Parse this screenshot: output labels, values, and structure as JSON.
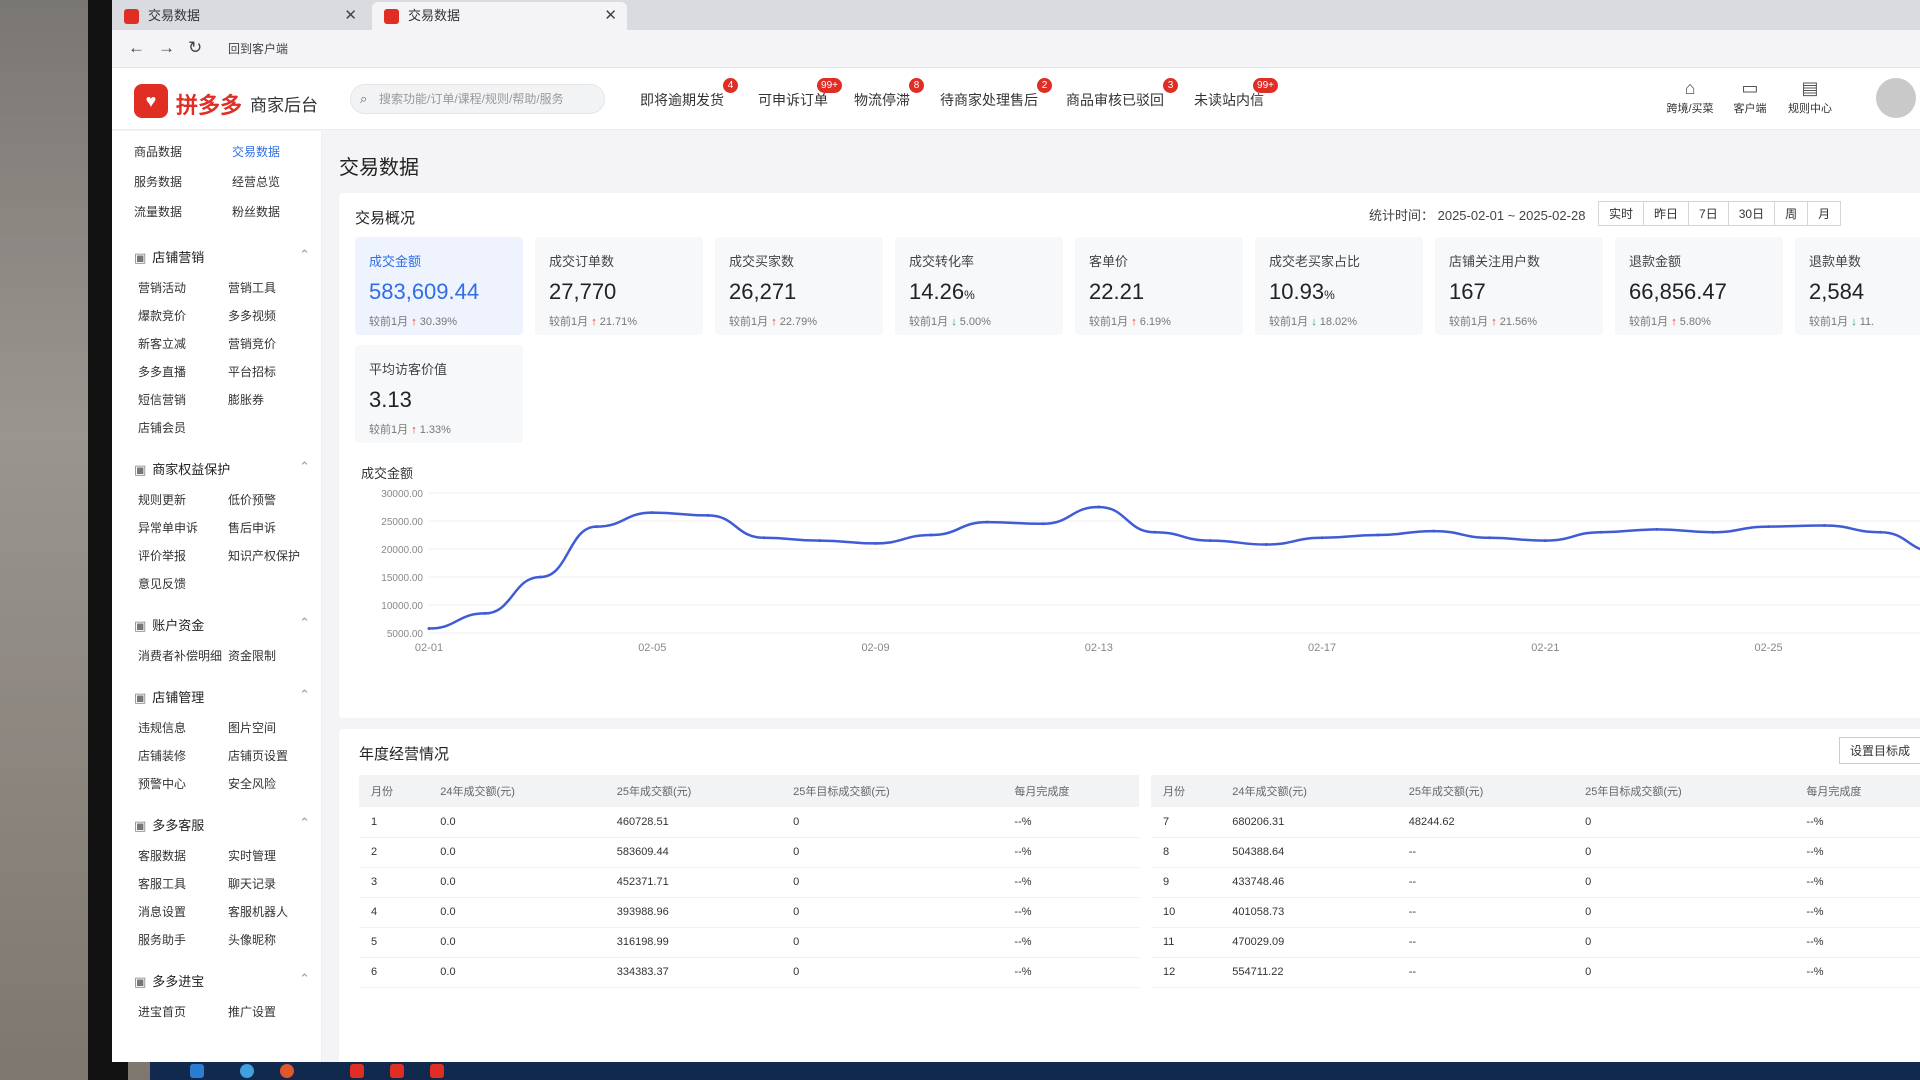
{
  "browser": {
    "tabs": [
      {
        "label": "交易数据"
      },
      {
        "label": "交易数据"
      }
    ],
    "address_label": "回到客户端"
  },
  "header": {
    "brand": "拼多多",
    "brand_sub": "商家后台",
    "search_placeholder": "搜索功能/订单/课程/规则/帮助/服务",
    "notices": [
      {
        "label": "即将逾期发货",
        "badge": "4"
      },
      {
        "label": "可申诉订单",
        "badge": "99+"
      },
      {
        "label": "物流停滞",
        "badge": "8"
      },
      {
        "label": "待商家处理售后",
        "badge": "2"
      },
      {
        "label": "商品审核已驳回",
        "badge": "3"
      },
      {
        "label": "未读站内信",
        "badge": "99+"
      }
    ],
    "tools": [
      "跨境/买菜",
      "客户端",
      "规则中心"
    ]
  },
  "sidebar": {
    "top_items": [
      [
        "商品数据",
        "交易数据"
      ],
      [
        "服务数据",
        "经营总览"
      ],
      [
        "流量数据",
        "粉丝数据"
      ]
    ],
    "sections": [
      {
        "title": "店铺营销",
        "items": [
          [
            "营销活动",
            "营销工具"
          ],
          [
            "爆款竞价",
            "多多视频"
          ],
          [
            "新客立减",
            "营销竞价"
          ],
          [
            "多多直播",
            "平台招标"
          ],
          [
            "短信营销",
            "膨胀券"
          ],
          [
            "店铺会员",
            ""
          ]
        ]
      },
      {
        "title": "商家权益保护",
        "items": [
          [
            "规则更新",
            "低价预警"
          ],
          [
            "异常单申诉",
            "售后申诉"
          ],
          [
            "评价举报",
            "知识产权保护"
          ],
          [
            "意见反馈",
            ""
          ]
        ]
      },
      {
        "title": "账户资金",
        "items": [
          [
            "消费者补偿明细",
            "资金限制"
          ]
        ]
      },
      {
        "title": "店铺管理",
        "items": [
          [
            "违规信息",
            "图片空间"
          ],
          [
            "店铺装修",
            "店铺页设置"
          ],
          [
            "预警中心",
            "安全风险"
          ]
        ]
      },
      {
        "title": "多多客服",
        "items": [
          [
            "客服数据",
            "实时管理"
          ],
          [
            "客服工具",
            "聊天记录"
          ],
          [
            "消息设置",
            "客服机器人"
          ],
          [
            "服务助手",
            "头像昵称"
          ]
        ]
      },
      {
        "title": "多多进宝",
        "items": [
          [
            "进宝首页",
            "推广设置"
          ]
        ]
      }
    ]
  },
  "main": {
    "title": "交易数据",
    "overview_title": "交易概况",
    "stat_time": "统计时间： 2025-02-01 ~ 2025-02-28",
    "ranges": [
      "实时",
      "昨日",
      "7日",
      "30日",
      "周",
      "月"
    ],
    "cards": [
      {
        "label": "成交金额",
        "value": "583,609.44",
        "unit": "",
        "cmp": "较前1月",
        "dir": "↑",
        "pct": "30.39%"
      },
      {
        "label": "成交订单数",
        "value": "27,770",
        "unit": "",
        "cmp": "较前1月",
        "dir": "↑",
        "pct": "21.71%"
      },
      {
        "label": "成交买家数",
        "value": "26,271",
        "unit": "",
        "cmp": "较前1月",
        "dir": "↑",
        "pct": "22.79%"
      },
      {
        "label": "成交转化率",
        "value": "14.26",
        "unit": "%",
        "cmp": "较前1月",
        "dir": "↓",
        "pct": "5.00%"
      },
      {
        "label": "客单价",
        "value": "22.21",
        "unit": "",
        "cmp": "较前1月",
        "dir": "↑",
        "pct": "6.19%"
      },
      {
        "label": "成交老买家占比",
        "value": "10.93",
        "unit": "%",
        "cmp": "较前1月",
        "dir": "↓",
        "pct": "18.02%"
      },
      {
        "label": "店铺关注用户数",
        "value": "167",
        "unit": "",
        "cmp": "较前1月",
        "dir": "↑",
        "pct": "21.56%"
      },
      {
        "label": "退款金额",
        "value": "66,856.47",
        "unit": "",
        "cmp": "较前1月",
        "dir": "↑",
        "pct": "5.80%"
      },
      {
        "label": "退款单数",
        "value": "2,584",
        "unit": "",
        "cmp": "较前1月",
        "dir": "↓",
        "pct": "11."
      },
      {
        "label": "平均访客价值",
        "value": "3.13",
        "unit": "",
        "cmp": "较前1月",
        "dir": "↑",
        "pct": "1.33%"
      }
    ],
    "chart_title": "成交金额"
  },
  "chart_data": {
    "type": "line",
    "title": "成交金额",
    "x": [
      "02-01",
      "02-02",
      "02-03",
      "02-04",
      "02-05",
      "02-06",
      "02-07",
      "02-08",
      "02-09",
      "02-10",
      "02-11",
      "02-12",
      "02-13",
      "02-14",
      "02-15",
      "02-16",
      "02-17",
      "02-18",
      "02-19",
      "02-20",
      "02-21",
      "02-22",
      "02-23",
      "02-24",
      "02-25",
      "02-26",
      "02-27",
      "02-28"
    ],
    "x_ticks": [
      "02-01",
      "02-05",
      "02-09",
      "02-13",
      "02-17",
      "02-21",
      "02-25"
    ],
    "y_ticks": [
      "30000.00",
      "25000.00",
      "20000.00",
      "15000.00",
      "10000.00",
      "5000.00"
    ],
    "ylim": [
      5000,
      30000
    ],
    "series": [
      {
        "values": [
          5800,
          8500,
          15000,
          24000,
          26500,
          26000,
          22000,
          21500,
          21000,
          22500,
          24800,
          24500,
          27500,
          23000,
          21500,
          20800,
          22000,
          22500,
          23200,
          22000,
          21500,
          23000,
          23500,
          23000,
          24000,
          24200,
          23000,
          19500
        ]
      }
    ],
    "color": "#3f5bd6",
    "grid": true
  },
  "year_table": {
    "title": "年度经营情况",
    "button": "设置目标成",
    "headers": [
      "月份",
      "24年成交额(元)",
      "25年成交额(元)",
      "25年目标成交额(元)",
      "每月完成度"
    ],
    "left_rows": [
      [
        "1",
        "0.0",
        "460728.51",
        "0",
        "--%"
      ],
      [
        "2",
        "0.0",
        "583609.44",
        "0",
        "--%"
      ],
      [
        "3",
        "0.0",
        "452371.71",
        "0",
        "--%"
      ],
      [
        "4",
        "0.0",
        "393988.96",
        "0",
        "--%"
      ],
      [
        "5",
        "0.0",
        "316198.99",
        "0",
        "--%"
      ],
      [
        "6",
        "0.0",
        "334383.37",
        "0",
        "--%"
      ]
    ],
    "right_rows": [
      [
        "7",
        "680206.31",
        "48244.62",
        "0",
        "--%"
      ],
      [
        "8",
        "504388.64",
        "--",
        "0",
        "--%"
      ],
      [
        "9",
        "433748.46",
        "--",
        "0",
        "--%"
      ],
      [
        "10",
        "401058.73",
        "--",
        "0",
        "--%"
      ],
      [
        "11",
        "470029.09",
        "--",
        "0",
        "--%"
      ],
      [
        "12",
        "554711.22",
        "--",
        "0",
        "--%"
      ]
    ]
  }
}
